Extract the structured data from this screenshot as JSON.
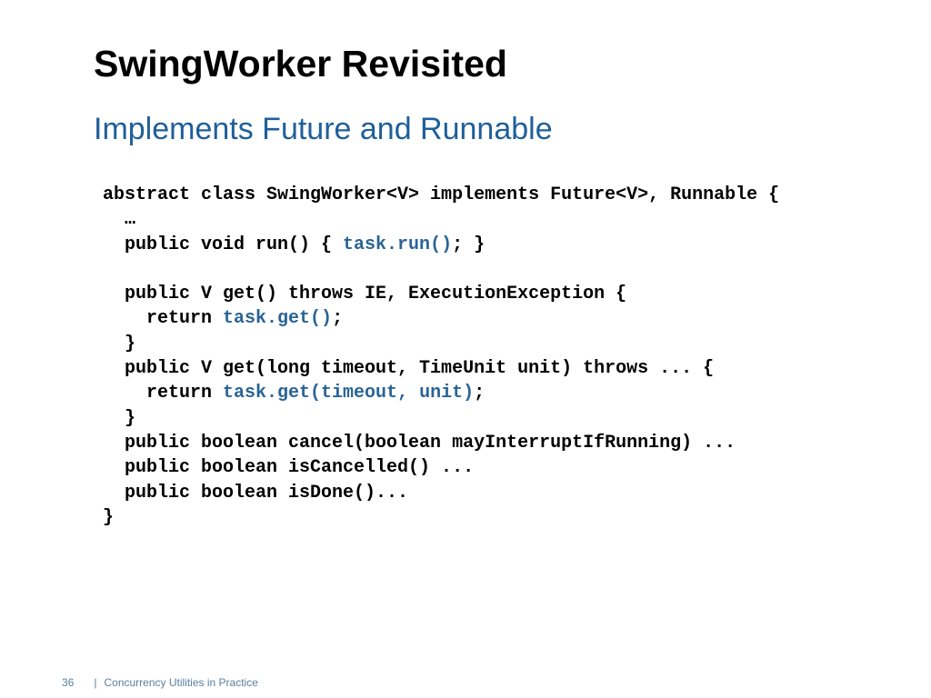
{
  "slide": {
    "title": "SwingWorker Revisited",
    "subtitle": "Implements Future and Runnable",
    "accent_color": "#1f5f99",
    "highlight_color": "#2a6496"
  },
  "code_lines": [
    [
      {
        "t": "abstract class SwingWorker<V> implements Future<V>, Runnable {"
      }
    ],
    [
      {
        "t": "  …"
      }
    ],
    [
      {
        "t": "  public void run() { "
      },
      {
        "t": "task.run()",
        "hl": true
      },
      {
        "t": "; }"
      }
    ],
    [
      {
        "t": ""
      }
    ],
    [
      {
        "t": "  public V get() throws IE, ExecutionException {"
      }
    ],
    [
      {
        "t": "    return "
      },
      {
        "t": "task.get()",
        "hl": true
      },
      {
        "t": ";"
      }
    ],
    [
      {
        "t": "  }"
      }
    ],
    [
      {
        "t": "  public V get(long timeout, TimeUnit unit) throws ... {"
      }
    ],
    [
      {
        "t": "    return "
      },
      {
        "t": "task.get(timeout, unit)",
        "hl": true
      },
      {
        "t": ";"
      }
    ],
    [
      {
        "t": "  }"
      }
    ],
    [
      {
        "t": "  public boolean cancel(boolean mayInterruptIfRunning) ..."
      }
    ],
    [
      {
        "t": "  public boolean isCancelled() ..."
      }
    ],
    [
      {
        "t": "  public boolean isDone()..."
      }
    ],
    [
      {
        "t": "}"
      }
    ]
  ],
  "footer": {
    "page_number": "36",
    "separator": "|",
    "text": "Concurrency Utilities in Practice"
  }
}
